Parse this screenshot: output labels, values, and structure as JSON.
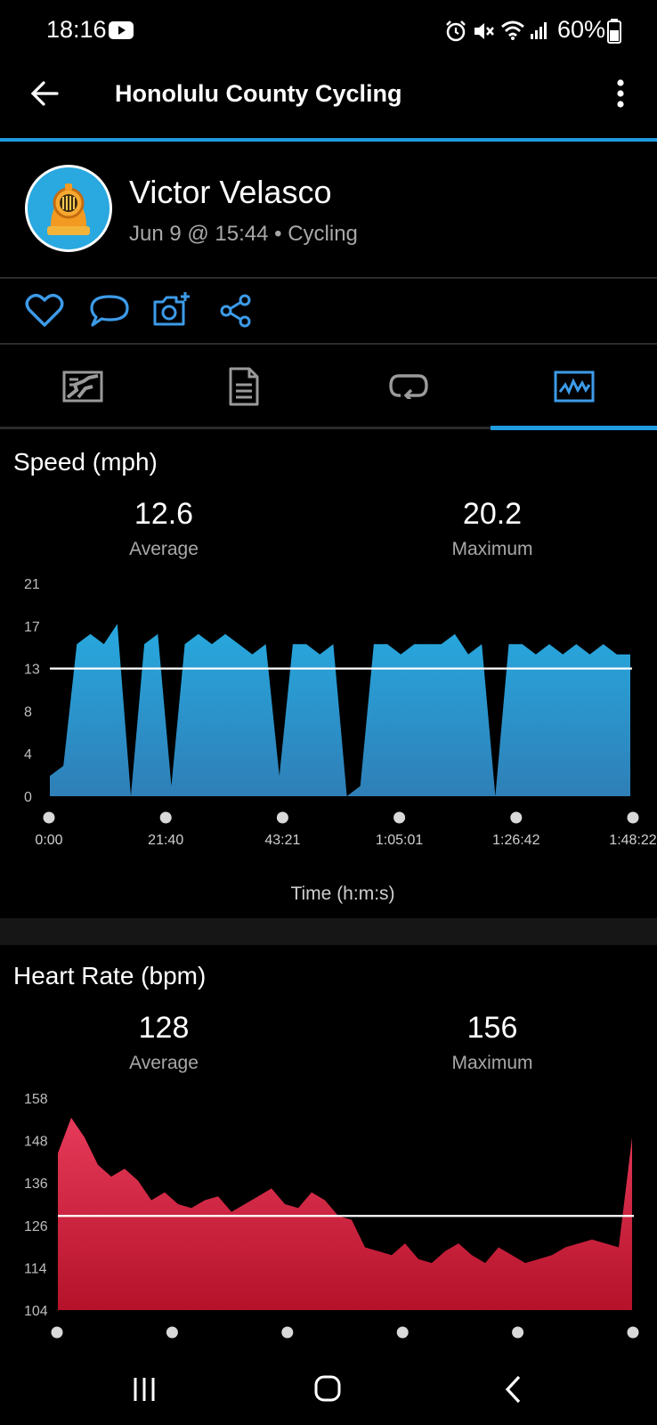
{
  "status_bar": {
    "time": "18:16",
    "battery": "60%",
    "icons": [
      "youtube-icon",
      "alarm-icon",
      "mute-icon",
      "wifi-icon",
      "signal-icon",
      "battery-icon"
    ]
  },
  "app_bar": {
    "title": "Honolulu County Cycling",
    "back_icon": "arrow-left-icon",
    "menu_icon": "more-vert-icon"
  },
  "profile": {
    "name": "Victor Velasco",
    "subtitle": "Jun 9 @ 15:44 • Cycling"
  },
  "actions": [
    "heart-icon",
    "comment-icon",
    "add-photo-icon",
    "share-icon"
  ],
  "tabs": [
    {
      "icon": "map-icon",
      "active": false
    },
    {
      "icon": "details-icon",
      "active": false
    },
    {
      "icon": "laps-icon",
      "active": false
    },
    {
      "icon": "charts-icon",
      "active": true
    }
  ],
  "speed": {
    "title": "Speed (mph)",
    "average_value": "12.6",
    "average_label": "Average",
    "maximum_value": "20.2",
    "maximum_label": "Maximum",
    "xlabel": "Time (h:m:s)"
  },
  "heart_rate": {
    "title": "Heart Rate (bpm)",
    "average_value": "128",
    "average_label": "Average",
    "maximum_value": "156",
    "maximum_label": "Maximum"
  },
  "colors": {
    "accent": "#1f9bde",
    "speed_fill_top": "#27a9df",
    "speed_fill_bottom": "#2f7fb7",
    "hr_fill_top": "#e63a5a",
    "hr_fill_bottom": "#b5122a"
  },
  "chart_data": [
    {
      "type": "area",
      "title": "Speed (mph)",
      "xlabel": "Time (h:m:s)",
      "ylabel": "",
      "ylim": [
        0,
        21
      ],
      "xlim": [
        "0:00",
        "1:48:22"
      ],
      "yticks": [
        "21",
        "17",
        "13",
        "8",
        "4",
        "0"
      ],
      "xticks": [
        "0:00",
        "21:40",
        "43:21",
        "1:05:01",
        "1:26:42",
        "1:48:22"
      ],
      "average_line": 12.6,
      "x": [
        "0:00",
        "2:30",
        "5:00",
        "7:30",
        "10:00",
        "12:30",
        "15:00",
        "17:30",
        "20:00",
        "22:30",
        "25:00",
        "27:30",
        "30:00",
        "32:30",
        "35:00",
        "37:30",
        "40:00",
        "42:30",
        "45:00",
        "47:30",
        "50:00",
        "52:30",
        "55:00",
        "57:30",
        "1:00:00",
        "1:02:30",
        "1:05:00",
        "1:07:30",
        "1:10:00",
        "1:12:30",
        "1:15:00",
        "1:17:30",
        "1:20:00",
        "1:22:30",
        "1:25:00",
        "1:27:30",
        "1:30:00",
        "1:32:30",
        "1:35:00",
        "1:37:30",
        "1:40:00",
        "1:42:30",
        "1:45:00",
        "1:48:22"
      ],
      "values": [
        2,
        3,
        15,
        16,
        15,
        17,
        0,
        15,
        16,
        1,
        15,
        16,
        15,
        16,
        15,
        14,
        15,
        2,
        15,
        15,
        14,
        15,
        0,
        1,
        15,
        15,
        14,
        15,
        15,
        15,
        16,
        14,
        15,
        0,
        15,
        15,
        14,
        15,
        14,
        15,
        14,
        15,
        14,
        14
      ]
    },
    {
      "type": "area",
      "title": "Heart Rate (bpm)",
      "xlabel": "",
      "ylabel": "",
      "ylim": [
        104,
        158
      ],
      "yticks": [
        "158",
        "148",
        "136",
        "126",
        "114",
        "104"
      ],
      "average_line": 128,
      "x": [
        "0:00",
        "2:30",
        "5:00",
        "7:30",
        "10:00",
        "12:30",
        "15:00",
        "17:30",
        "20:00",
        "22:30",
        "25:00",
        "27:30",
        "30:00",
        "32:30",
        "35:00",
        "37:30",
        "40:00",
        "42:30",
        "45:00",
        "47:30",
        "50:00",
        "52:30",
        "55:00",
        "57:30",
        "1:00:00",
        "1:02:30",
        "1:05:00",
        "1:07:30",
        "1:10:00",
        "1:12:30",
        "1:15:00",
        "1:17:30",
        "1:20:00",
        "1:22:30",
        "1:25:00",
        "1:27:30",
        "1:30:00",
        "1:32:30",
        "1:35:00",
        "1:37:30",
        "1:40:00",
        "1:42:30",
        "1:45:00",
        "1:48:22"
      ],
      "values": [
        144,
        153,
        148,
        141,
        138,
        140,
        137,
        132,
        134,
        131,
        130,
        132,
        133,
        129,
        131,
        133,
        135,
        131,
        130,
        134,
        132,
        128,
        127,
        120,
        119,
        118,
        121,
        117,
        116,
        119,
        121,
        118,
        116,
        120,
        118,
        116,
        117,
        118,
        120,
        121,
        122,
        121,
        120,
        148
      ]
    }
  ]
}
